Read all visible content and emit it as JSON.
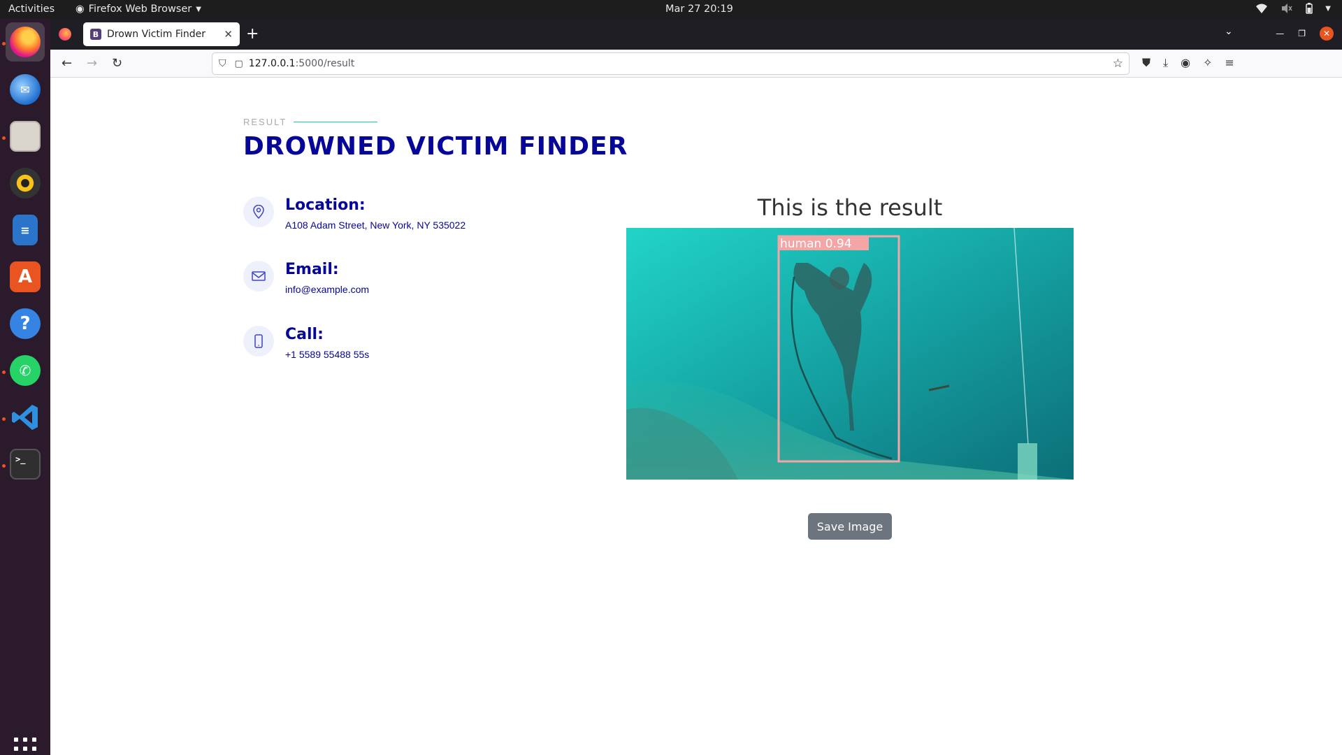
{
  "system_bar": {
    "activities": "Activities",
    "app_name": "Firefox Web Browser",
    "datetime": "Mar 27  20:19"
  },
  "dock": {
    "apps": [
      {
        "name": "firefox-icon",
        "active": true
      },
      {
        "name": "thunderbird-icon"
      },
      {
        "name": "files-icon"
      },
      {
        "name": "rhythmbox-icon"
      },
      {
        "name": "libreoffice-writer-icon"
      },
      {
        "name": "app-center-icon"
      },
      {
        "name": "help-icon"
      },
      {
        "name": "whatsapp-icon"
      },
      {
        "name": "vscode-icon"
      },
      {
        "name": "terminal-icon"
      }
    ]
  },
  "browser": {
    "tab_title": "Drown Victim Finder",
    "tab_favicon": "B",
    "url_host": "127.0.0.1",
    "url_path": ":5000/result"
  },
  "page": {
    "section_label": "RESULT",
    "title": "DROWNED VICTIM FINDER",
    "contact": {
      "location_title": "Location:",
      "location_text": "A108 Adam Street, New York, NY 535022",
      "email_title": "Email:",
      "email_text": "info@example.com",
      "call_title": "Call:",
      "call_text": "+1 5589 55488 55s"
    },
    "result_heading": "This is the result",
    "detection_label": "human  0.94",
    "save_button": "Save Image"
  },
  "colors": {
    "title_blue": "#060698",
    "accent_line": "#1ec8a5",
    "button_gray": "#6c757d",
    "detection_box": "#f4a5a5",
    "water": "#1bb3b0"
  }
}
